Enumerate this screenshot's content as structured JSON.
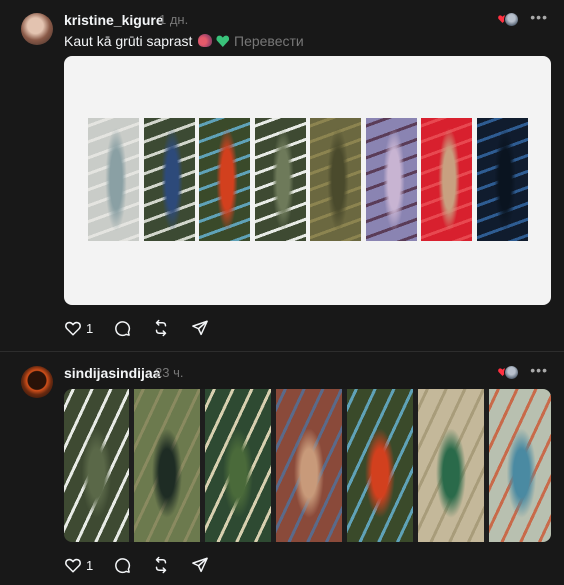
{
  "posts": [
    {
      "username": "kristine_kigure",
      "time": "1 дн.",
      "caption": "Kaut kā grūti saprast",
      "translate_label": "Перевести",
      "likes": "1",
      "strips": [
        {
          "name": "glacier-strip",
          "colors": [
            "#c9ccc8",
            "#e4e4e0",
            "#8aa0a4"
          ]
        },
        {
          "name": "mountain-snow-strip",
          "colors": [
            "#3c4a33",
            "#d2d6cc",
            "#2d4a7a"
          ]
        },
        {
          "name": "fire-smoke-strip",
          "colors": [
            "#3a4a2a",
            "#5fa2b8",
            "#d2401e"
          ]
        },
        {
          "name": "river-meander-strip",
          "colors": [
            "#3e4a32",
            "#e8ebe6",
            "#6e7a5a"
          ]
        },
        {
          "name": "olive-terrain-strip",
          "colors": [
            "#6b6840",
            "#8c8450",
            "#4a4a2c"
          ]
        },
        {
          "name": "purple-terrain-strip",
          "colors": [
            "#8a84b2",
            "#5a3c58",
            "#c8b4d2"
          ]
        },
        {
          "name": "red-infrared-strip",
          "colors": [
            "#d8202e",
            "#e84850",
            "#c8a080"
          ]
        },
        {
          "name": "ocean-bloom-strip",
          "colors": [
            "#101c2e",
            "#2e5c92",
            "#0a1420"
          ]
        }
      ]
    },
    {
      "username": "sindijasindijaa",
      "time": "23 ч.",
      "likes": "1",
      "tiles": [
        {
          "name": "river-meander-tile",
          "colors": [
            "#3e4a32",
            "#e8ebe6",
            "#5a6848"
          ]
        },
        {
          "name": "dark-lake-tile",
          "colors": [
            "#6c7a4e",
            "#8a8a60",
            "#1e2c24"
          ]
        },
        {
          "name": "green-river-tile",
          "colors": [
            "#2e4a32",
            "#d8d0b0",
            "#4a6a3a"
          ]
        },
        {
          "name": "red-lake-tile",
          "colors": [
            "#8a4a3a",
            "#5a6a8a",
            "#c89a7a"
          ]
        },
        {
          "name": "fire-smoke-tile",
          "colors": [
            "#3a4a2a",
            "#5fa2b8",
            "#d2401e"
          ]
        },
        {
          "name": "desert-lake-tile",
          "colors": [
            "#c4b89a",
            "#a89c7a",
            "#2a6a4a"
          ]
        },
        {
          "name": "delta-tile",
          "colors": [
            "#b8c0b0",
            "#c86a4a",
            "#4a8aa2"
          ]
        }
      ]
    }
  ]
}
